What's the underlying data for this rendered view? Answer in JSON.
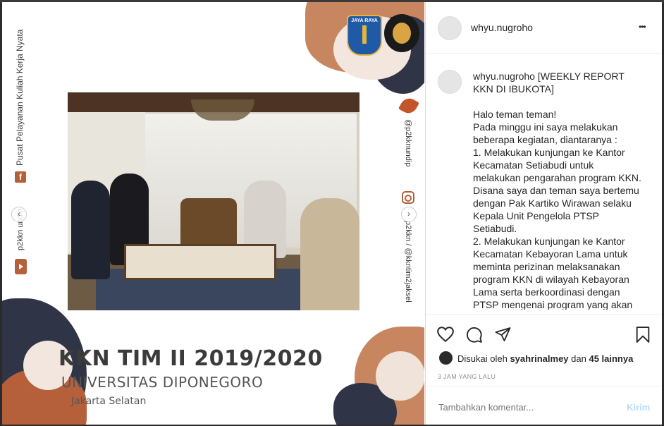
{
  "post": {
    "overlay_vertical_left": "Pusat Pelayanan Kuliah Kerja Nyata",
    "overlay_left_handle": "p2kkn undip",
    "overlay_right_handle_top": "@p2kknundip",
    "overlay_right_handle_bottom": "p2kkn / @kkntim2jaksel",
    "logo_left_text": "JAYA RAYA",
    "title_main": "KKN TIM II 2019/2020",
    "title_sub": "UNIVERSITAS DIPONEGORO",
    "title_location": "Jakarta Selatan",
    "nav_prev": "‹",
    "nav_next": "›"
  },
  "header": {
    "username": "whyu.nugroho",
    "more_label": "•••"
  },
  "caption": {
    "username": "whyu.nugroho",
    "title": " [WEEKLY REPORT KKN DI IBUKOTA]",
    "body": "Halo teman teman!\nPada minggu ini saya melakukan beberapa kegiatan, diantaranya :\n1. Melakukan kunjungan ke Kantor Kecamatan Setiabudi untuk melakukan pengarahan program KKN. Disana saya dan teman saya bertemu dengan Pak Kartiko Wirawan selaku Kepala Unit Pengelola PTSP Setiabudi.\n2. Melakukan kunjungan ke Kantor Kecamatan Kebayoran Lama untuk meminta perizinan melaksanakan program KKN di wilayah Kebayoran Lama serta berkoordinasi dengan PTSP mengenai program yang akan dilaksanakan. Disana kami disambut"
  },
  "actions": {
    "likes_prefix": "Disukai oleh ",
    "likes_user": "syahrinalmey",
    "likes_mid": " dan ",
    "likes_count": "45 lainnya",
    "timestamp": "3 JAM YANG LALU"
  },
  "comment": {
    "placeholder": "Tambahkan komentar...",
    "submit_label": "Kirim"
  },
  "colors": {
    "accent_brown": "#b5603a",
    "dark_navy": "#2f3446",
    "link_blue": "#b2dffc"
  }
}
